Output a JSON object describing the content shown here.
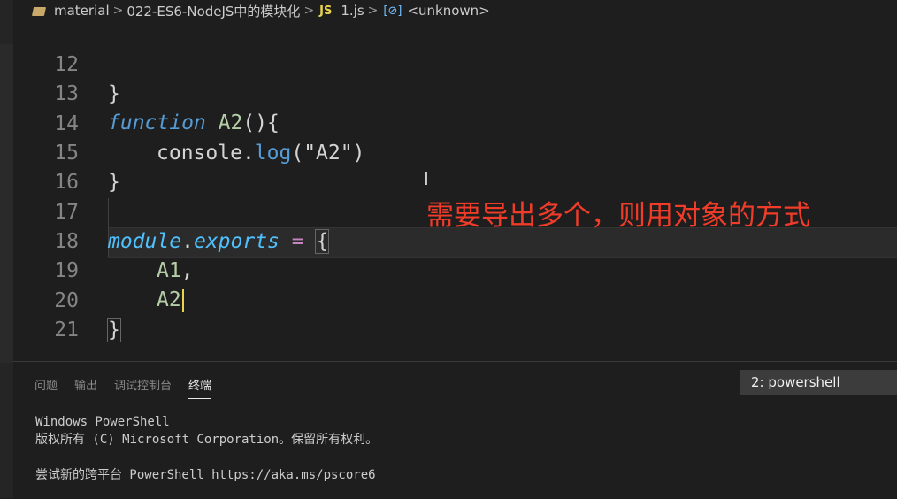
{
  "breadcrumb": {
    "folder": "material",
    "subfolder": "022-ES6-NodeJS中的模块化",
    "file_badge": "JS",
    "file": "1.js",
    "symbol_badge": "[⊘]",
    "symbol": "<unknown>"
  },
  "editor": {
    "lines": [
      {
        "n": "12"
      },
      {
        "n": "13"
      },
      {
        "n": "14"
      },
      {
        "n": "15"
      },
      {
        "n": "16"
      },
      {
        "n": "17"
      },
      {
        "n": "18"
      },
      {
        "n": "19"
      },
      {
        "n": "20"
      },
      {
        "n": "21"
      }
    ],
    "code": {
      "l12_brace": "}",
      "l13_kw": "function",
      "l13_name": "A2",
      "l13_rest": "(){",
      "l14_obj": "console",
      "l14_dot": ".",
      "l14_fn": "log",
      "l14_open": "(",
      "l14_str": "\"A2\"",
      "l14_close": ")",
      "l15_brace": "}",
      "l17_module": "module",
      "l17_dot": ".",
      "l17_exports": "exports",
      "l17_eq": " = ",
      "l17_brace": "{",
      "l18_item": "A1",
      "l18_comma": ",",
      "l19_item": "A2",
      "l20_brace": "}"
    },
    "annotation": "需要导出多个，则用对象的方式"
  },
  "panel": {
    "tabs": [
      {
        "label": "问题",
        "active": false
      },
      {
        "label": "输出",
        "active": false
      },
      {
        "label": "调试控制台",
        "active": false
      },
      {
        "label": "终端",
        "active": true
      }
    ],
    "terminal_select": "2: powershell",
    "terminal_lines": [
      "Windows PowerShell",
      "版权所有 (C) Microsoft Corporation。保留所有权利。",
      "",
      "尝试新的跨平台 PowerShell https://aka.ms/pscore6"
    ]
  },
  "colors": {
    "background": "#1e1e1e",
    "keyword": "#569cd6",
    "string": "#ce9178",
    "annotation": "#f03c28",
    "js_badge": "#e8d44d"
  }
}
